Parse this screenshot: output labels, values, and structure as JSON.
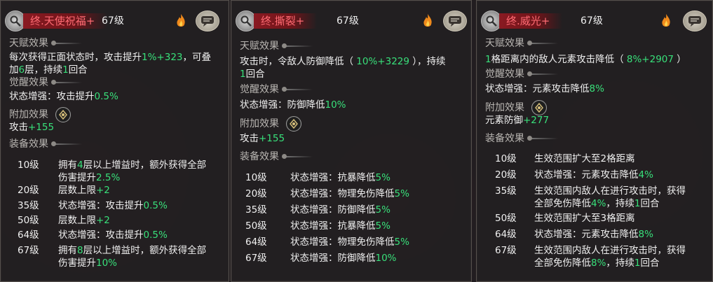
{
  "panels": [
    {
      "name": "终.天使祝福+",
      "level": "67级",
      "talent_title": "天赋效果",
      "talent_lines": [
        [
          {
            "t": "每次获得正面状态时，攻击提升",
            "c": "w"
          },
          {
            "t": "1%+323",
            "c": "g"
          },
          {
            "t": "，可叠",
            "c": "w"
          }
        ],
        [
          {
            "t": "加",
            "c": "w"
          },
          {
            "t": "6",
            "c": "g"
          },
          {
            "t": "层，持续",
            "c": "w"
          },
          {
            "t": "1",
            "c": "g"
          },
          {
            "t": "回合",
            "c": "w"
          }
        ]
      ],
      "awaken_title": "觉醒效果",
      "awaken": [
        {
          "t": "状态增强：攻击提升",
          "c": "w"
        },
        {
          "t": "0.5%",
          "c": "g"
        }
      ],
      "extra_title": "附加效果",
      "extra": [
        {
          "t": "攻击",
          "c": "w"
        },
        {
          "t": "+155",
          "c": "g"
        }
      ],
      "equip_title": "装备效果",
      "equip": [
        {
          "lv": "10级",
          "lines": [
            [
              {
                "t": "拥有",
                "c": "w"
              },
              {
                "t": "4",
                "c": "g"
              },
              {
                "t": "层以上增益时，额外获得全部",
                "c": "w"
              }
            ],
            [
              {
                "t": "伤害提升",
                "c": "w"
              },
              {
                "t": "2.5%",
                "c": "g"
              }
            ]
          ]
        },
        {
          "lv": "20级",
          "lines": [
            [
              {
                "t": "层数上限",
                "c": "w"
              },
              {
                "t": "+2",
                "c": "g"
              }
            ]
          ]
        },
        {
          "lv": "35级",
          "lines": [
            [
              {
                "t": "状态增强：攻击提升",
                "c": "w"
              },
              {
                "t": "0.5%",
                "c": "g"
              }
            ]
          ]
        },
        {
          "lv": "50级",
          "lines": [
            [
              {
                "t": "层数上限",
                "c": "w"
              },
              {
                "t": "+2",
                "c": "g"
              }
            ]
          ]
        },
        {
          "lv": "64级",
          "lines": [
            [
              {
                "t": "状态增强：攻击提升",
                "c": "w"
              },
              {
                "t": "0.5%",
                "c": "g"
              }
            ]
          ]
        },
        {
          "lv": "67级",
          "lines": [
            [
              {
                "t": "拥有",
                "c": "w"
              },
              {
                "t": "8",
                "c": "g"
              },
              {
                "t": "层以上增益时，额外获得全部",
                "c": "w"
              }
            ],
            [
              {
                "t": "伤害提升",
                "c": "w"
              },
              {
                "t": "10%",
                "c": "g"
              }
            ]
          ]
        }
      ]
    },
    {
      "name": "终.撕裂+",
      "level": "67级",
      "talent_title": "天赋效果",
      "talent_lines": [
        [
          {
            "t": "攻击时，令敌人防御降低（ ",
            "c": "w"
          },
          {
            "t": "10%+3229",
            "c": "g"
          },
          {
            "t": " ），持续",
            "c": "w"
          }
        ],
        [
          {
            "t": "1",
            "c": "g"
          },
          {
            "t": "回合",
            "c": "w"
          }
        ]
      ],
      "awaken_title": "觉醒效果",
      "awaken": [
        {
          "t": "状态增强：防御降低",
          "c": "w"
        },
        {
          "t": "10%",
          "c": "g"
        }
      ],
      "extra_title": "附加效果",
      "extra": [
        {
          "t": "攻击",
          "c": "w"
        },
        {
          "t": "+155",
          "c": "g"
        }
      ],
      "equip_title": "装备效果",
      "equip": [
        {
          "lv": "10级",
          "lines": [
            [
              {
                "t": "状态增强：抗暴降低",
                "c": "w"
              },
              {
                "t": "5%",
                "c": "g"
              }
            ]
          ]
        },
        {
          "lv": "20级",
          "lines": [
            [
              {
                "t": "状态增强：物理免伤降低",
                "c": "w"
              },
              {
                "t": "5%",
                "c": "g"
              }
            ]
          ]
        },
        {
          "lv": "35级",
          "lines": [
            [
              {
                "t": "状态增强：防御降低",
                "c": "w"
              },
              {
                "t": "5%",
                "c": "g"
              }
            ]
          ]
        },
        {
          "lv": "50级",
          "lines": [
            [
              {
                "t": "状态增强：抗暴降低",
                "c": "w"
              },
              {
                "t": "5%",
                "c": "g"
              }
            ]
          ]
        },
        {
          "lv": "64级",
          "lines": [
            [
              {
                "t": "状态增强：物理免伤降低",
                "c": "w"
              },
              {
                "t": "5%",
                "c": "g"
              }
            ]
          ]
        },
        {
          "lv": "67级",
          "lines": [
            [
              {
                "t": "状态增强：防御降低",
                "c": "w"
              },
              {
                "t": "10%",
                "c": "g"
              }
            ]
          ]
        }
      ]
    },
    {
      "name": "终.威光+",
      "level": "67级",
      "talent_title": "天赋效果",
      "talent_lines": [
        [
          {
            "t": "1",
            "c": "g"
          },
          {
            "t": "格距离内的敌人元素攻击降低（ ",
            "c": "w"
          },
          {
            "t": "8%+2907",
            "c": "g"
          },
          {
            "t": " ）",
            "c": "w"
          }
        ]
      ],
      "awaken_title": "觉醒效果",
      "awaken": [
        {
          "t": "状态增强：元素攻击降低",
          "c": "w"
        },
        {
          "t": "8%",
          "c": "g"
        }
      ],
      "extra_title": "附加效果",
      "extra": [
        {
          "t": "元素防御",
          "c": "w"
        },
        {
          "t": "+277",
          "c": "g"
        }
      ],
      "equip_title": "装备效果",
      "equip": [
        {
          "lv": "10级",
          "lines": [
            [
              {
                "t": "生效范围扩大至2格距离",
                "c": "w"
              }
            ]
          ]
        },
        {
          "lv": "20级",
          "lines": [
            [
              {
                "t": "状态增强：元素攻击降低",
                "c": "w"
              },
              {
                "t": "4%",
                "c": "g"
              }
            ]
          ]
        },
        {
          "lv": "35级",
          "lines": [
            [
              {
                "t": "生效范围内敌人在进行攻击时，获得",
                "c": "w"
              }
            ],
            [
              {
                "t": "全部免伤降低",
                "c": "w"
              },
              {
                "t": "4%",
                "c": "g"
              },
              {
                "t": "，持续",
                "c": "w"
              },
              {
                "t": "1",
                "c": "g"
              },
              {
                "t": "回合",
                "c": "w"
              }
            ]
          ]
        },
        {
          "lv": "50级",
          "lines": [
            [
              {
                "t": "生效范围扩大至3格距离",
                "c": "w"
              }
            ]
          ]
        },
        {
          "lv": "64级",
          "lines": [
            [
              {
                "t": "状态增强：元素攻击降低",
                "c": "w"
              },
              {
                "t": "8%",
                "c": "g"
              }
            ]
          ]
        },
        {
          "lv": "67级",
          "lines": [
            [
              {
                "t": "生效范围内敌人在进行攻击时，获得",
                "c": "w"
              }
            ],
            [
              {
                "t": "全部免伤降低",
                "c": "w"
              },
              {
                "t": "8%",
                "c": "g"
              },
              {
                "t": "，持续",
                "c": "w"
              },
              {
                "t": "1",
                "c": "g"
              },
              {
                "t": "回合",
                "c": "w"
              }
            ]
          ]
        }
      ]
    }
  ],
  "colors": {
    "green": "#38e07a",
    "title_red": "#ff6b73",
    "section": "#b9b6b2"
  },
  "icons": [
    "skill-icon",
    "flame-icon",
    "chat-icon",
    "attribute-icon"
  ]
}
